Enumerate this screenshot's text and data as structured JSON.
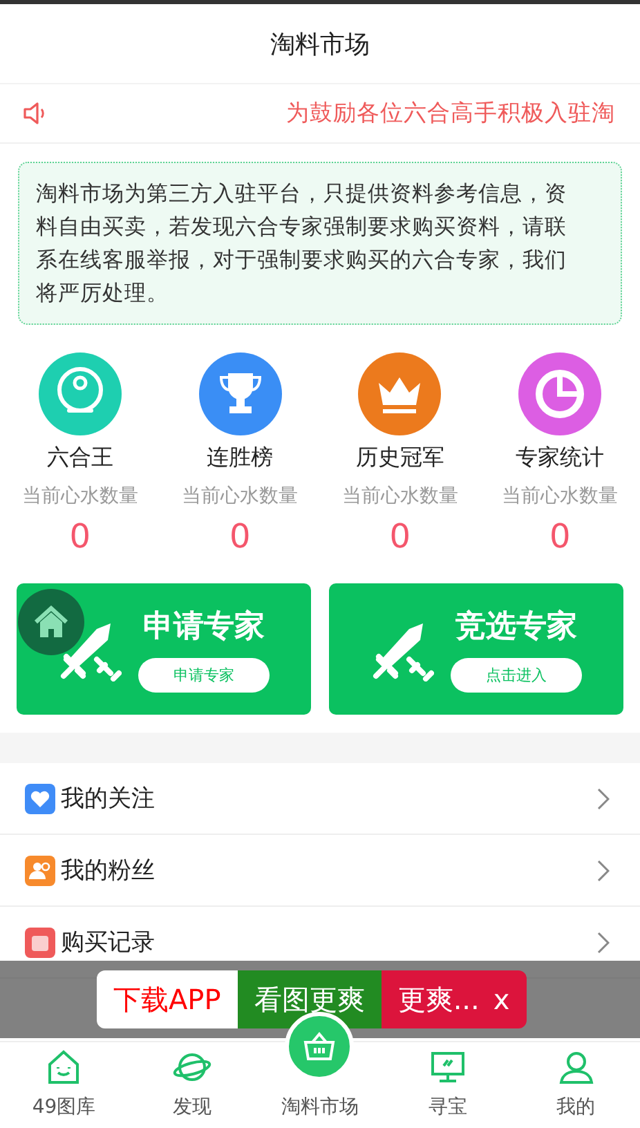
{
  "header": {
    "title": "淘料市场"
  },
  "marquee": {
    "text": "为鼓励各位六合高手积极入驻淘"
  },
  "notice": {
    "text": "淘料市场为第三方入驻平台，只提供资料参考信息，资料自由买卖，若发现六合专家强制要求购买资料，请联系在线客服举报，对于强制要求购买的六合专家，我们将严厉处理。"
  },
  "stats": [
    {
      "title": "六合王",
      "subtitle": "当前心水数量",
      "count": "0",
      "color": "#1ecfb0"
    },
    {
      "title": "连胜榜",
      "subtitle": "当前心水数量",
      "count": "0",
      "color": "#3a8ef5"
    },
    {
      "title": "历史冠军",
      "subtitle": "当前心水数量",
      "count": "0",
      "color": "#ec7a1d"
    },
    {
      "title": "专家统计",
      "subtitle": "当前心水数量",
      "count": "0",
      "color": "#dc5ee3"
    }
  ],
  "actions": [
    {
      "title": "申请专家",
      "button": "申请专家"
    },
    {
      "title": "竞选专家",
      "button": "点击进入"
    }
  ],
  "menu": [
    {
      "label": "我的关注",
      "color": "#3f8cf7"
    },
    {
      "label": "我的粉丝",
      "color": "#f78a2c"
    },
    {
      "label": "购买记录",
      "color": "#ef5a5a"
    }
  ],
  "banner": {
    "segments": [
      {
        "text": "下载APP",
        "kind": "light"
      },
      {
        "text": "看图更爽",
        "kind": "green"
      },
      {
        "text": "更爽...",
        "kind": "red"
      }
    ],
    "close": "x"
  },
  "bottom_nav": [
    {
      "label": "49图库",
      "kind": "plain"
    },
    {
      "label": "发现",
      "kind": "plain"
    },
    {
      "label": "淘料市场",
      "kind": "raised"
    },
    {
      "label": "寻宝",
      "kind": "plain"
    },
    {
      "label": "我的",
      "kind": "plain"
    }
  ]
}
